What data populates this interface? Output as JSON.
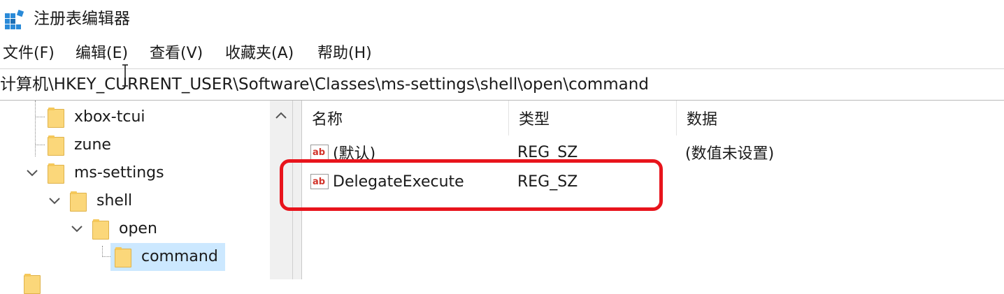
{
  "window": {
    "title": "注册表编辑器"
  },
  "menu": [
    {
      "label": "文件(F)"
    },
    {
      "label": "编辑(E)"
    },
    {
      "label": "查看(V)"
    },
    {
      "label": "收藏夹(A)"
    },
    {
      "label": "帮助(H)"
    }
  ],
  "address": {
    "path": "计算机\\HKEY_CURRENT_USER\\Software\\Classes\\ms-settings\\shell\\open\\command"
  },
  "tree": [
    {
      "label": "xbox-tcui",
      "expanded": false,
      "selected": false
    },
    {
      "label": "zune",
      "expanded": false,
      "selected": false
    },
    {
      "label": "ms-settings",
      "expanded": true,
      "selected": false
    },
    {
      "label": "shell",
      "expanded": true,
      "selected": false
    },
    {
      "label": "open",
      "expanded": true,
      "selected": false
    },
    {
      "label": "command",
      "expanded": false,
      "selected": true
    }
  ],
  "list": {
    "columns": [
      "名称",
      "类型",
      "数据"
    ],
    "rows": [
      {
        "name": "(默认)",
        "type": "REG_SZ",
        "data": "(数值未设置)",
        "icon": "string-value-icon"
      },
      {
        "name": "DelegateExecute",
        "type": "REG_SZ",
        "data": "",
        "icon": "string-value-icon"
      }
    ]
  },
  "colors": {
    "selection": "#cce8ff",
    "highlight_box": "#e8141c",
    "folder": "#fbd77a"
  }
}
